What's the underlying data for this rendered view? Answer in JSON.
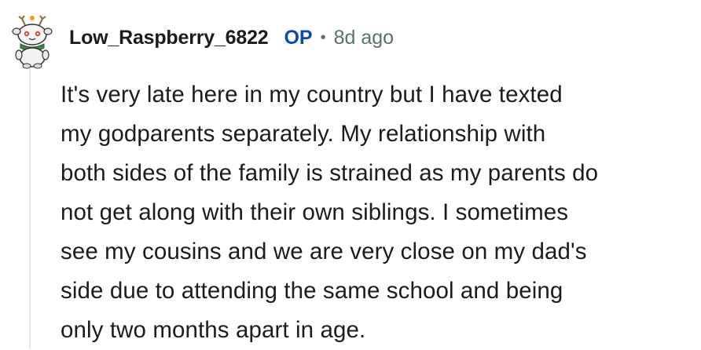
{
  "comment": {
    "author": "Low_Raspberry_6822",
    "op_badge": "OP",
    "separator": "•",
    "timestamp": "8d ago",
    "body_lines": [
      "It's very late here in my country but I have texted",
      "my godparents separately. My relationship with",
      "both sides of the family is strained as my parents do",
      "not get along with their own siblings. I sometimes",
      "see my cousins and we are very close on my dad's",
      "side due to attending the same school and being",
      "only two months apart in age."
    ],
    "avatar_icon": "snoo-avatar-icon"
  },
  "colors": {
    "op_accent": "#0a49b8",
    "meta_text": "#576f76",
    "thread_line": "#e5e7e9",
    "text": "#1c1c1c"
  }
}
